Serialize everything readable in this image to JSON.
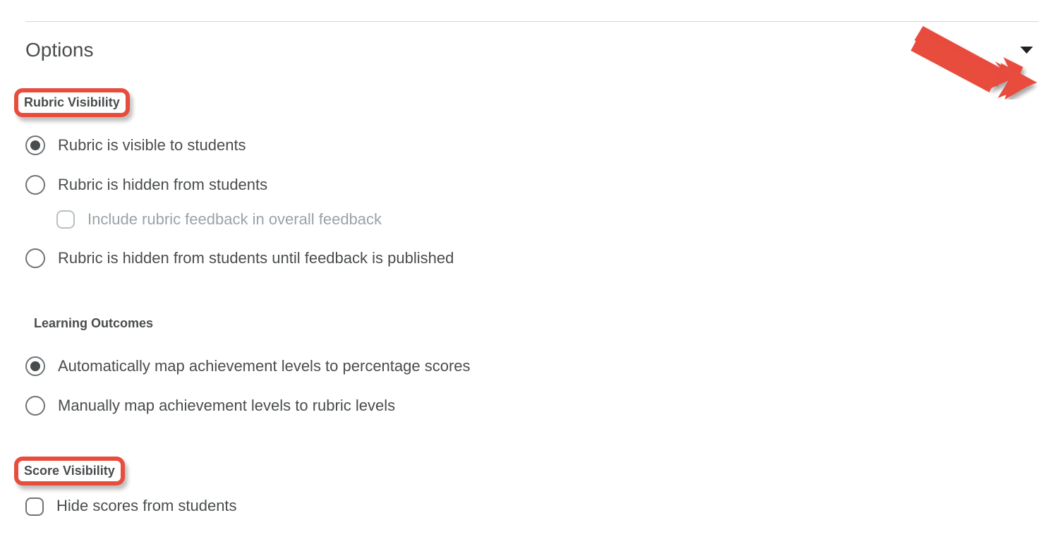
{
  "header": {
    "title": "Options"
  },
  "groups": {
    "rubric_visibility": {
      "label": "Rubric Visibility",
      "options": {
        "visible": "Rubric is visible to students",
        "hidden": "Rubric is hidden from students",
        "include_feedback": "Include rubric feedback in overall feedback",
        "hidden_until_published": "Rubric is hidden from students until feedback is published"
      },
      "selected": "visible"
    },
    "learning_outcomes": {
      "label": "Learning Outcomes",
      "options": {
        "auto_map": "Automatically map achievement levels to percentage scores",
        "manual_map": "Manually map achievement levels to rubric levels"
      },
      "selected": "auto_map"
    },
    "score_visibility": {
      "label": "Score Visibility",
      "options": {
        "hide_scores": "Hide scores from students"
      },
      "hide_scores_checked": false
    }
  }
}
